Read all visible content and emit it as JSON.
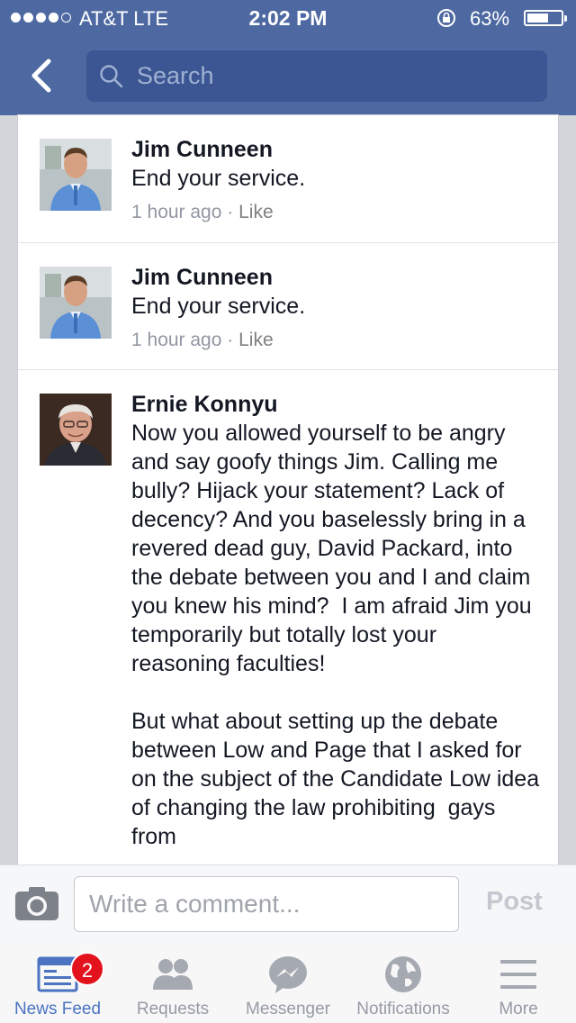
{
  "status_bar": {
    "carrier": "AT&T  LTE",
    "time": "2:02 PM",
    "battery": "63%",
    "battery_level": 0.63
  },
  "nav": {
    "back_icon": "chevron-left-icon",
    "search_placeholder": "Search"
  },
  "comments": [
    {
      "author": "Jim Cunneen",
      "text": "End your service.",
      "time": "1 hour ago",
      "sep": " · ",
      "like": "Like"
    },
    {
      "author": "Jim Cunneen",
      "text": "End your service.",
      "time": "1 hour ago",
      "sep": " · ",
      "like": "Like"
    },
    {
      "author": "Ernie Konnyu",
      "text": "Now you allowed yourself to be angry and say goofy things Jim. Calling me bully? Hijack your statement? Lack of decency? And you baselessly bring in a revered dead guy, David Packard, into the debate between you and I and claim you knew his mind?  I am afraid Jim you temporarily but totally lost your reasoning faculties!\n\nBut what about setting up the debate between Low and Page that I asked for on the subject of the Candidate Low idea of changing the law prohibiting  gays from"
    }
  ],
  "composer": {
    "camera_icon": "camera-icon",
    "placeholder": "Write a comment...",
    "post_label": "Post"
  },
  "tabbar": {
    "tabs": [
      {
        "label": "News Feed",
        "icon": "news-feed-icon",
        "badge": "2",
        "active": true
      },
      {
        "label": "Requests",
        "icon": "friends-icon"
      },
      {
        "label": "Messenger",
        "icon": "messenger-icon"
      },
      {
        "label": "Notifications",
        "icon": "globe-icon"
      },
      {
        "label": "More",
        "icon": "menu-icon"
      }
    ]
  },
  "colors": {
    "nav_bg": "#4e69a2",
    "search_bg": "#3b5692",
    "active_tab": "#4b73c1",
    "badge": "#e3131d"
  }
}
